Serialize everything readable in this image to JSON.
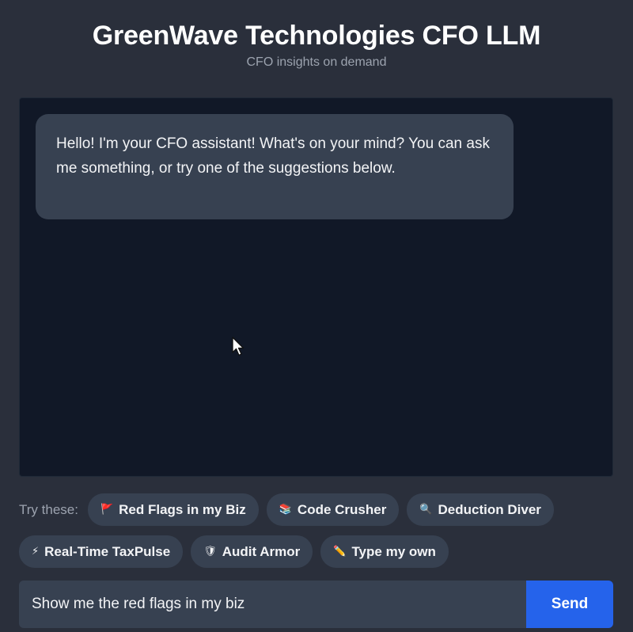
{
  "app": {
    "title": "GreenWave Technologies CFO LLM",
    "subtitle": "CFO insights on demand"
  },
  "chat": {
    "messages": [
      {
        "role": "assistant",
        "text": "Hello! I'm your CFO assistant! What's on your mind? You can ask me something, or try one of the suggestions below."
      }
    ]
  },
  "suggestions": {
    "label": "Try these:",
    "chips": [
      {
        "emoji": "🚩",
        "label": "Red Flags in my Biz"
      },
      {
        "emoji": "📚",
        "label": "Code Crusher"
      },
      {
        "emoji": "🔍",
        "label": "Deduction Diver"
      },
      {
        "emoji": "⚡",
        "label": "Real-Time TaxPulse"
      },
      {
        "emoji": "🛡",
        "label": "Audit Armor"
      },
      {
        "emoji": "✏️",
        "label": "Type my own"
      }
    ]
  },
  "composer": {
    "value": "Show me the red flags in my biz",
    "send_label": "Send"
  },
  "colors": {
    "page_bg": "#2a2f3b",
    "chat_bg": "#111827",
    "bubble_bg": "#374151",
    "chip_bg": "#374151",
    "send_bg": "#2563eb"
  }
}
